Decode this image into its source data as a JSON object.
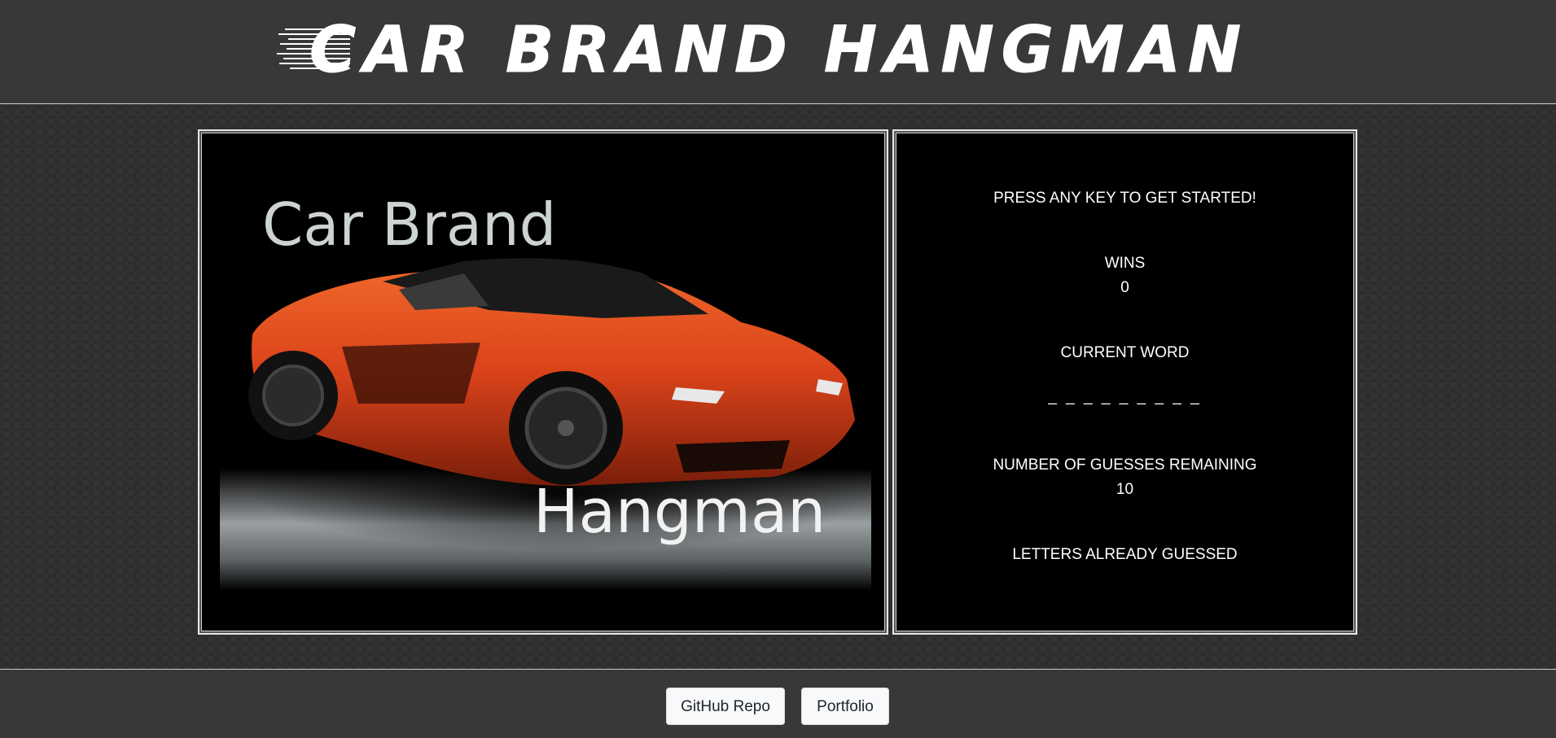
{
  "header": {
    "title": "Car Brand Hangman"
  },
  "hero": {
    "line1": "Car Brand",
    "line2": "Hangman",
    "image": "orange-sports-car-image"
  },
  "game": {
    "prompt": "PRESS ANY KEY TO GET STARTED!",
    "wins_label": "WINS",
    "wins_value": "0",
    "current_word_label": "CURRENT WORD",
    "current_word_value": "_ _ _ _ _ _ _ _ _",
    "guesses_label": "NUMBER OF GUESSES REMAINING",
    "guesses_value": "10",
    "letters_guessed_label": "LETTERS ALREADY GUESSED",
    "letters_guessed_value": ""
  },
  "footer": {
    "github_label": "GitHub Repo",
    "portfolio_label": "Portfolio"
  },
  "colors": {
    "background": "#2b2b2b",
    "bar": "#383838",
    "panel": "#000000",
    "car": "#e2461a",
    "text": "#ffffff"
  }
}
